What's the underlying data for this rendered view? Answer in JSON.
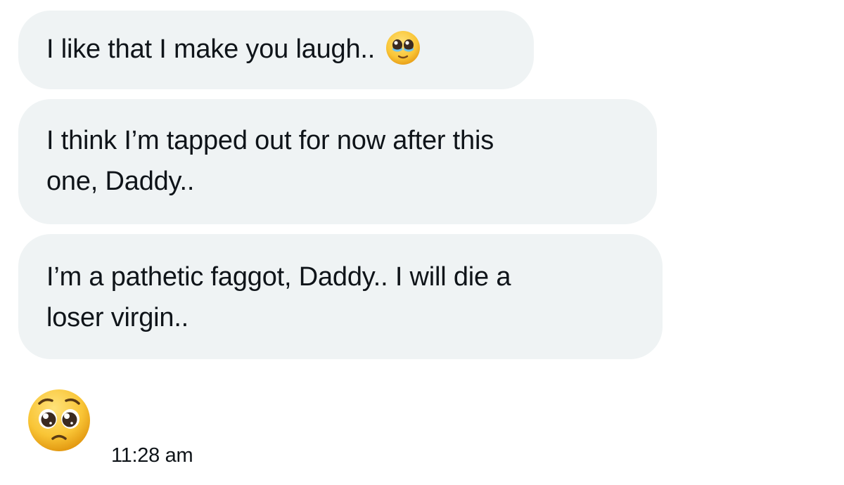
{
  "messages": [
    {
      "lines": [
        "I like that I make you laugh.."
      ],
      "emoji_icon": "pleading-face-with-tears-icon"
    },
    {
      "lines": [
        "I think I’m tapped out for now after this",
        "one, Daddy.."
      ]
    },
    {
      "lines": [
        "I’m a pathetic faggot, Daddy.. I will die a",
        "loser virgin.."
      ]
    }
  ],
  "reaction": {
    "icon": "pleading-face-icon"
  },
  "timestamp": "11:28 am",
  "colors": {
    "bubble_bg": "#eff3f4",
    "text": "#0f1419",
    "page_bg": "#ffffff",
    "emoji_yellow": "#f9c536",
    "emoji_tear": "#6ec6f0"
  }
}
